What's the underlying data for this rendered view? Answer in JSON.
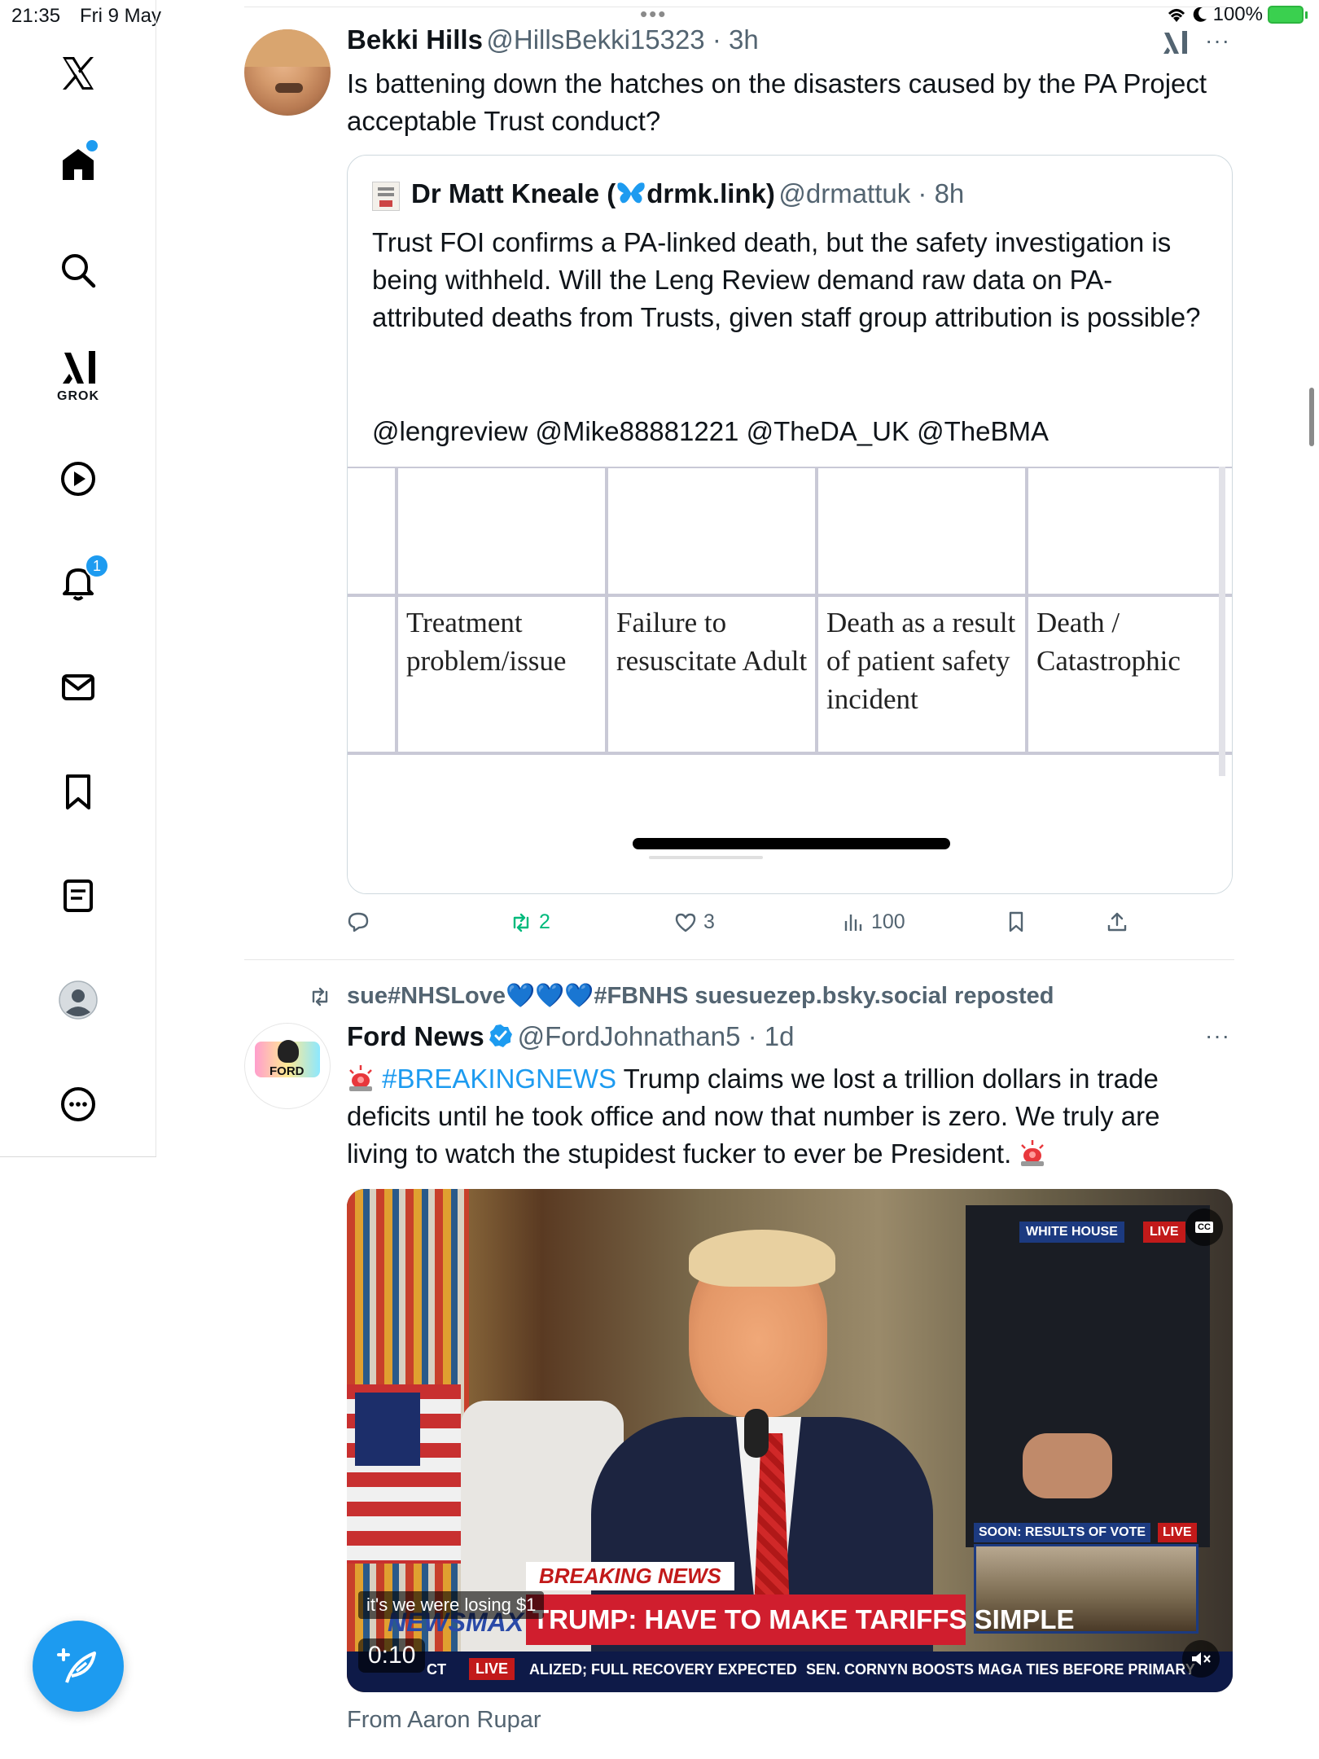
{
  "status_bar": {
    "time": "21:35",
    "date": "Fri 9 May",
    "battery_label": "100%"
  },
  "sidebar": {
    "items": [
      {
        "name": "X"
      },
      {
        "name": "Home"
      },
      {
        "name": "Search"
      },
      {
        "name": "Grok",
        "label": "GROK"
      },
      {
        "name": "Video"
      },
      {
        "name": "Notifications",
        "badge": "1"
      },
      {
        "name": "Messages"
      },
      {
        "name": "Bookmarks"
      },
      {
        "name": "Lists"
      },
      {
        "name": "Profile"
      },
      {
        "name": "More"
      }
    ]
  },
  "tweet1": {
    "name": "Bekki Hills",
    "handle": "@HillsBekki15323",
    "time": "3h",
    "text": "Is battening down the hatches on the disasters caused by the PA Project acceptable Trust conduct?",
    "quote": {
      "name_prefix": "Dr Matt Kneale (",
      "name_link": "drmk.link)",
      "handle": "@drmattuk",
      "time": "8h",
      "text": "Trust FOI confirms a PA-linked death, but the safety investigation is being withheld. Will the Leng Review demand raw data on PA-attributed deaths from Trusts, given staff group attribution is possible?",
      "mentions": "@lengreview @Mike88881221 @TheDA_UK @TheBMA",
      "table_cells": [
        [
          "Treatment",
          "problem/issue"
        ],
        [
          "Failure to",
          "resuscitate Adult"
        ],
        [
          "Death as a result",
          "of patient safety",
          "incident"
        ],
        [
          "Death /",
          "Catastrophic"
        ]
      ]
    },
    "actions": {
      "reposts": "2",
      "likes": "3",
      "views": "100"
    }
  },
  "tweet2": {
    "repost_by": "sue#NHSLove💙💙💙#FBNHS suesuezep.bsky.social reposted",
    "name": "Ford News",
    "handle": "@FordJohnathan5",
    "time": "1d",
    "hashtag": "#BREAKINGNEWS",
    "text": " Trump claims we lost a trillion dollars in trade deficits until he took office and now that number is zero. We truly are living to watch the stupidest fucker to ever be President.",
    "video": {
      "chip_white_house": "WHITE HOUSE",
      "chip_live": "LIVE",
      "cc": "CC",
      "soon": "SOON: RESULTS OF VOTE",
      "soon_live": "LIVE",
      "breaking": "BREAKING NEWS",
      "headline": "TRUMP: HAVE TO MAKE TARIFFS SIMPLE",
      "network": "NEWSMAX",
      "caption": "it's we were losing $1",
      "timer": "0:10",
      "ticker_ct": "CT",
      "ticker_live": "LIVE",
      "ticker1": "ALIZED; FULL RECOVERY EXPECTED",
      "ticker2": "SEN. CORNYN BOOSTS MAGA TIES BEFORE PRIMARY"
    },
    "from": "From Aaron Rupar"
  },
  "colors": {
    "accent": "#1d9bf0",
    "repost_green": "#00ba7c"
  }
}
